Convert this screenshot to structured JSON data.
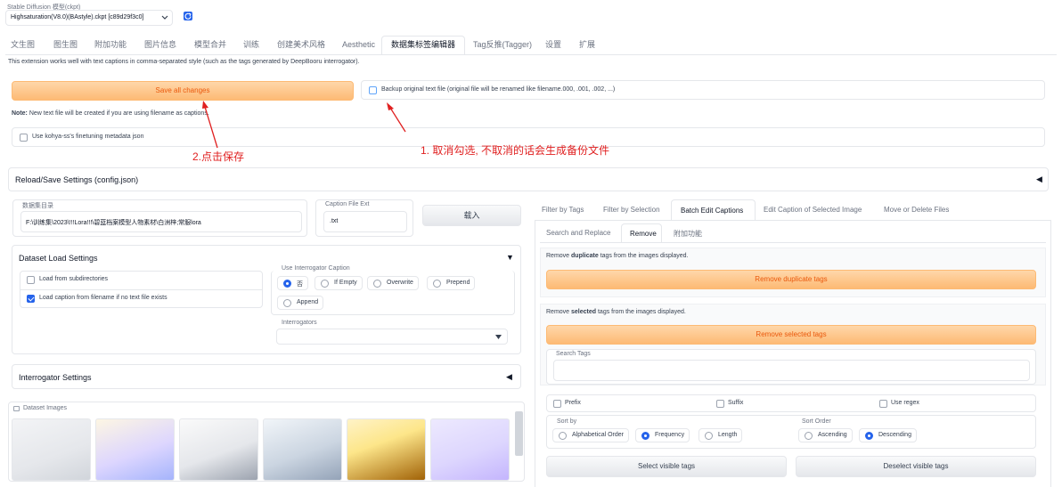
{
  "model": {
    "label": "Stable Diffusion 模型(ckpt)",
    "value": "Highsaturation(V8.0)(BAstyle).ckpt [c89d29f3c0]"
  },
  "tabs": [
    "文生图",
    "图生图",
    "附加功能",
    "图片信息",
    "模型合并",
    "训练",
    "创建美术风格",
    "Aesthetic",
    "数据集标签编辑器",
    "Tag反推(Tagger)",
    "设置",
    "扩展"
  ],
  "active_tab": "数据集标签编辑器",
  "intro": "This extension works well with text captions in comma-separated style (such as the tags generated by DeepBooru interrogator).",
  "save_label": "Save all changes",
  "backup_label": "Backup original text file (original file will be renamed like filename.000, .001, .002, ...)",
  "note_prefix": "Note:",
  "note_text": " New text file will be created if you are using filename as captions.",
  "kohya_label": "Use kohya-ss's finetuning metadata json",
  "annotation_1": "1. 取消勾选, 不取消的话会生成备份文件",
  "annotation_2": "2.点击保存",
  "reload_label": "Reload/Save Settings (config.json)",
  "dataset_dir_label": "数据集目录",
  "dataset_dir_value": "F:\\训练集\\2023\\!!!Lora!!!\\碧蓝档案模型人物素材\\白洲梓;常服lora",
  "caption_ext_label": "Caption File Ext",
  "caption_ext_value": ".txt",
  "load_button": "载入",
  "dataset_load_settings": "Dataset Load Settings",
  "load_subdirs": "Load from subdirectories",
  "load_caption_from_filename": "Load caption from filename if no text file exists",
  "use_interrogator_label": "Use Interrogator Caption",
  "interrogator_options": [
    "否",
    "If Empty",
    "Overwrite",
    "Prepend",
    "Append"
  ],
  "interrogators_label": "Interrogators",
  "interrogator_settings": "Interrogator Settings",
  "dataset_images_label": "Dataset Images",
  "right_tabs": [
    "Filter by Tags",
    "Filter by Selection",
    "Batch Edit Captions",
    "Edit Caption of Selected Image",
    "Move or Delete Files"
  ],
  "right_active": "Batch Edit Captions",
  "sub_tabs": [
    "Search and Replace",
    "Remove",
    "附加功能"
  ],
  "sub_active": "Remove",
  "remove_dup_desc": {
    "pre": "Remove ",
    "bold": "duplicate",
    "post": " tags from the images displayed."
  },
  "remove_dup_button": "Remove duplicate tags",
  "remove_sel_desc": {
    "pre": "Remove ",
    "bold": "selected",
    "post": " tags from the images displayed."
  },
  "remove_sel_button": "Remove selected tags",
  "search_tags_label": "Search Tags",
  "prefix_label": "Prefix",
  "suffix_label": "Suffix",
  "regex_label": "Use regex",
  "sort_by_label": "Sort by",
  "sort_by_options": [
    "Alphabetical Order",
    "Frequency",
    "Length"
  ],
  "sort_order_label": "Sort Order",
  "sort_order_options": [
    "Ascending",
    "Descending"
  ],
  "select_visible": "Select visible tags",
  "deselect_visible": "Deselect visible tags",
  "colors": {
    "accent": "#2563eb",
    "orange": "#fdba74",
    "orange_text": "#ea580c",
    "annotation": "#e02020"
  }
}
